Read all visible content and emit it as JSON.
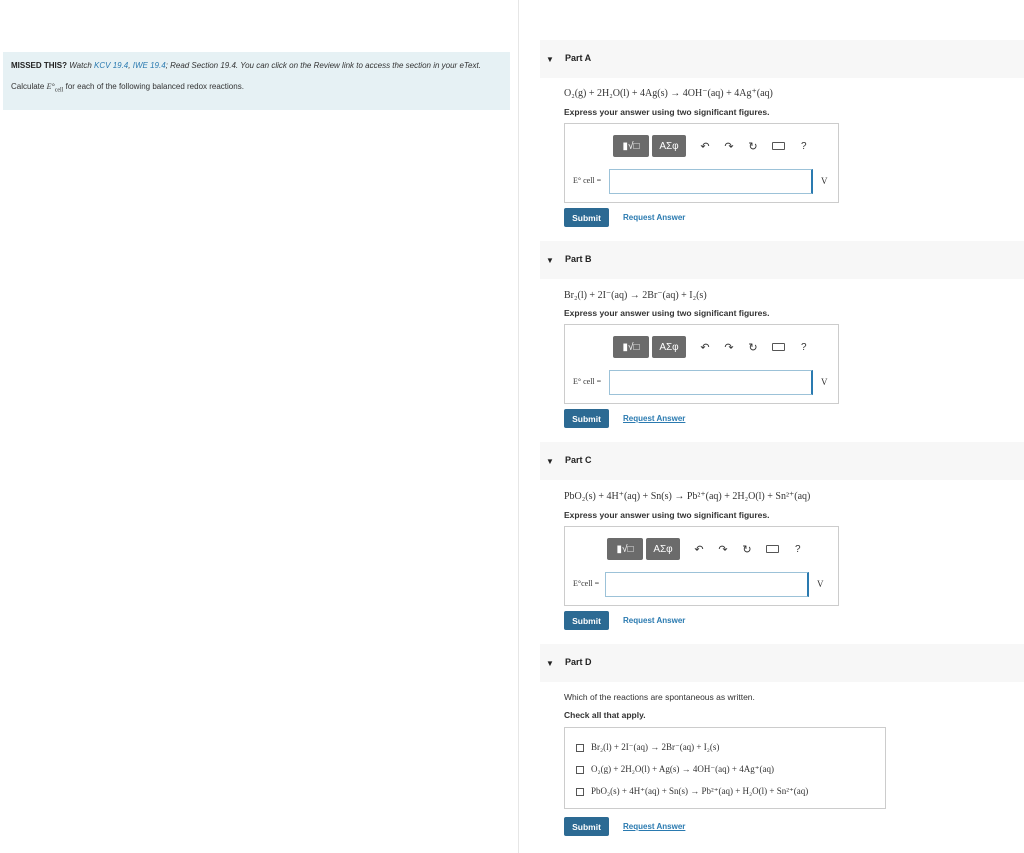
{
  "intro": {
    "missed_label": "MISSED THIS?",
    "watch_text": "Watch",
    "link1": "KCV 19.4",
    "sep": ",",
    "link2": "IWE 19.4",
    "read_text": "; Read Section 19.4. You can click on the Review link to access the section in your",
    "etext": "eText.",
    "calc_prefix": "Calculate",
    "calc_var": "E°",
    "calc_sub": "cell",
    "calc_suffix": "for each of the following balanced redox reactions."
  },
  "toolbar": {
    "templates_label": "▮√□",
    "greek_label": "ΑΣφ",
    "undo_icon": "↶",
    "redo_icon": "↷",
    "reset_icon": "↻",
    "help_label": "?"
  },
  "parts": [
    {
      "label": "Part A",
      "equation": "O₂(g) + 2H₂O(l) + 4Ag(s) → 4OH⁻(aq) + 4Ag⁺(aq)",
      "instruction": "Express your answer using two significant figures.",
      "var_label": "E° cell =",
      "unit": "V",
      "submit": "Submit",
      "request": "Request Answer"
    },
    {
      "label": "Part B",
      "equation": "Br₂(l) + 2I⁻(aq) → 2Br⁻(aq) + I₂(s)",
      "instruction": "Express your answer using two significant figures.",
      "var_label": "E° cell =",
      "unit": "V",
      "submit": "Submit",
      "request": "Request Answer"
    },
    {
      "label": "Part C",
      "equation": "PbO₂(s) + 4H⁺(aq) + Sn(s) → Pb²⁺(aq) + 2H₂O(l) + Sn²⁺(aq)",
      "instruction": "Express your answer using two significant figures.",
      "var_label": "E°cell =",
      "unit": "V",
      "submit": "Submit",
      "request": "Request Answer"
    },
    {
      "label": "Part D",
      "question": "Which of the reactions are spontaneous as written.",
      "instruction": "Check all that apply.",
      "options": [
        "Br₂(l) + 2I⁻(aq) → 2Br⁻(aq) + I₂(s)",
        "O₂(g) + 2H₂O(l) + Ag(s) → 4OH⁻(aq) + 4Ag⁺(aq)",
        "PbO₂(s) + 4H⁺(aq) + Sn(s) → Pb²⁺(aq) + H₂O(l) + Sn²⁺(aq)"
      ],
      "submit": "Submit",
      "request": "Request Answer"
    }
  ]
}
